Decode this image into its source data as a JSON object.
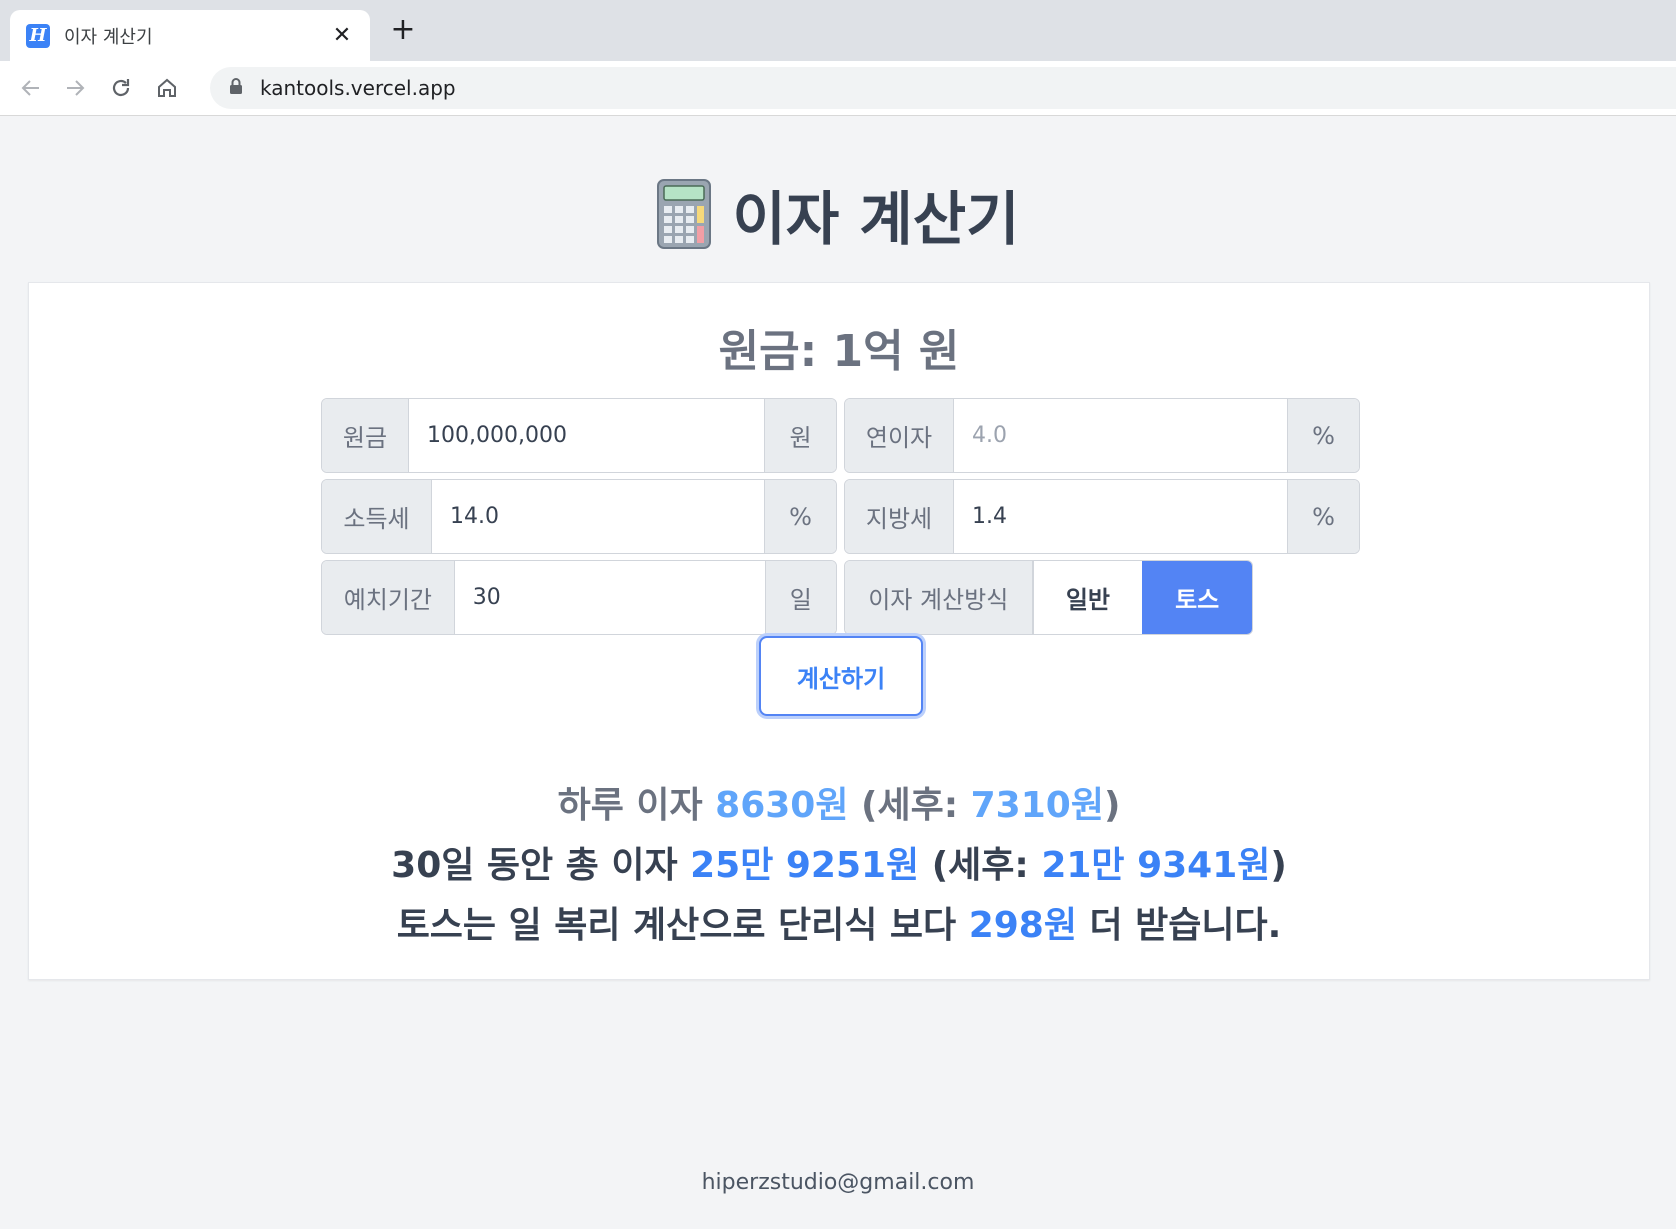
{
  "browser": {
    "tab_title": "이자 계산기",
    "favicon_letter": "H",
    "url": "kantools.vercel.app"
  },
  "page": {
    "title": "이자 계산기",
    "card_title": "원금: 1억 원",
    "fields": {
      "principal": {
        "label": "원금",
        "value": "100,000,000",
        "unit": "원"
      },
      "annual_rate": {
        "label": "연이자",
        "placeholder": "4.0",
        "unit": "%"
      },
      "income_tax": {
        "label": "소득세",
        "value": "14.0",
        "unit": "%"
      },
      "local_tax": {
        "label": "지방세",
        "value": "1.4",
        "unit": "%"
      },
      "period": {
        "label": "예치기간",
        "value": "30",
        "unit": "일"
      },
      "method": {
        "label": "이자 계산방식",
        "options": [
          "일반",
          "토스"
        ],
        "selected": "토스"
      }
    },
    "calculate_button": "계산하기",
    "results": {
      "line1": {
        "prefix": "하루 이자 ",
        "daily": "8630원",
        "mid": " (세후: ",
        "daily_after_tax": "7310원",
        "suffix": ")"
      },
      "line2": {
        "prefix": "30일 동안 총 이자 ",
        "total": "25만 9251원",
        "mid": " (세후: ",
        "total_after_tax": "21만 9341원",
        "suffix": ")"
      },
      "line3": {
        "prefix": "토스는 일 복리 계산으로 단리식 보다 ",
        "diff": "298원",
        "suffix": " 더 받습니다."
      }
    },
    "footer": "hiperzstudio@gmail.com"
  },
  "colors": {
    "accent": "#5384f4",
    "highlight_light": "#60a5fa",
    "highlight": "#3b82f6",
    "background": "#f3f4f6"
  }
}
